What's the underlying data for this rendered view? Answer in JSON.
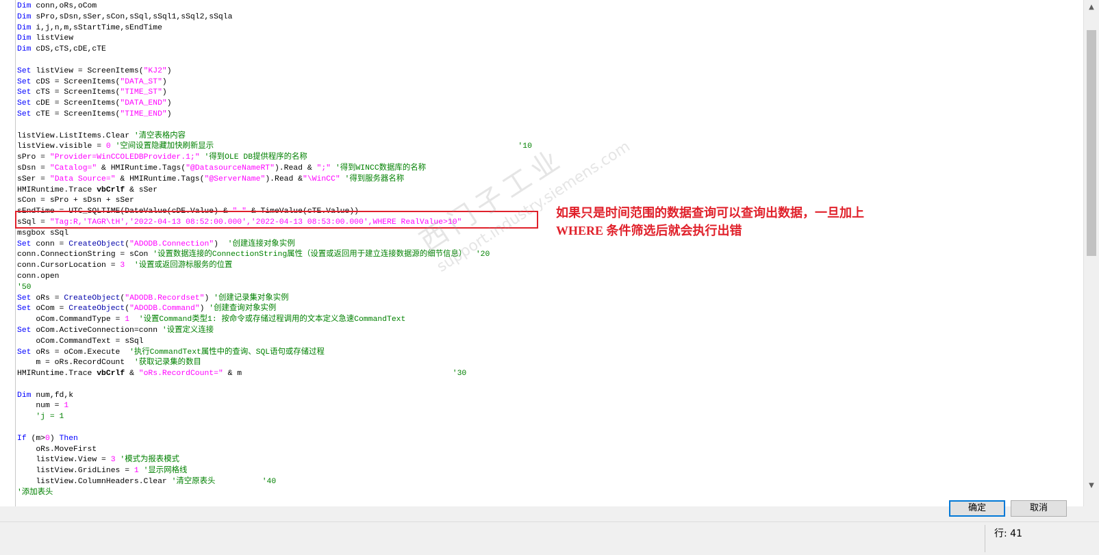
{
  "editor": {
    "lines": [
      [
        {
          "t": "Dim",
          "c": "kw"
        },
        {
          "t": " conn,oRs,oCom"
        }
      ],
      [
        {
          "t": "Dim",
          "c": "kw"
        },
        {
          "t": " sPro,sDsn,sSer,sCon,sSql,sSql1,sSql2,sSqla"
        }
      ],
      [
        {
          "t": "Dim",
          "c": "kw"
        },
        {
          "t": " i,j,n,m,sStartTime,sEndTime"
        }
      ],
      [
        {
          "t": "Dim",
          "c": "kw"
        },
        {
          "t": " listView"
        }
      ],
      [
        {
          "t": "Dim",
          "c": "kw"
        },
        {
          "t": " cDS,cTS,cDE,cTE"
        }
      ],
      [],
      [
        {
          "t": "Set",
          "c": "kw"
        },
        {
          "t": " listView = ScreenItems("
        },
        {
          "t": "\"KJ2\"",
          "c": "str"
        },
        {
          "t": ")"
        }
      ],
      [
        {
          "t": "Set",
          "c": "kw"
        },
        {
          "t": " cDS = ScreenItems("
        },
        {
          "t": "\"DATA_ST\"",
          "c": "str"
        },
        {
          "t": ")"
        }
      ],
      [
        {
          "t": "Set",
          "c": "kw"
        },
        {
          "t": " cTS = ScreenItems("
        },
        {
          "t": "\"TIME_ST\"",
          "c": "str"
        },
        {
          "t": ")"
        }
      ],
      [
        {
          "t": "Set",
          "c": "kw"
        },
        {
          "t": " cDE = ScreenItems("
        },
        {
          "t": "\"DATA_END\"",
          "c": "str"
        },
        {
          "t": ")"
        }
      ],
      [
        {
          "t": "Set",
          "c": "kw"
        },
        {
          "t": " cTE = ScreenItems("
        },
        {
          "t": "\"TIME_END\"",
          "c": "str"
        },
        {
          "t": ")"
        }
      ],
      [],
      [
        {
          "t": "listView.ListItems.Clear "
        },
        {
          "t": "'清空表格内容",
          "c": "cm"
        }
      ],
      [
        {
          "t": "listView.visible = "
        },
        {
          "t": "0",
          "c": "num"
        },
        {
          "t": " "
        },
        {
          "t": "'空间设置隐藏加快刷新显示                                                                 '10",
          "c": "cm"
        }
      ],
      [
        {
          "t": "sPro = "
        },
        {
          "t": "\"Provider=WinCCOLEDBProvider.1;\"",
          "c": "str"
        },
        {
          "t": " "
        },
        {
          "t": "'得到OLE DB提供程序的名称",
          "c": "cm"
        }
      ],
      [
        {
          "t": "sDsn = "
        },
        {
          "t": "\"Catalog=\"",
          "c": "str"
        },
        {
          "t": " & HMIRuntime.Tags("
        },
        {
          "t": "\"@DatasourceNameRT\"",
          "c": "str"
        },
        {
          "t": ").Read & "
        },
        {
          "t": "\";\"",
          "c": "str"
        },
        {
          "t": " "
        },
        {
          "t": "'得到WINCC数据库的名称",
          "c": "cm"
        }
      ],
      [
        {
          "t": "sSer = "
        },
        {
          "t": "\"Data Source=\"",
          "c": "str"
        },
        {
          "t": " & HMIRuntime.Tags("
        },
        {
          "t": "\"@ServerName\"",
          "c": "str"
        },
        {
          "t": ").Read &"
        },
        {
          "t": "\"\\WinCC\"",
          "c": "str"
        },
        {
          "t": " "
        },
        {
          "t": "'得到服务器名称",
          "c": "cm"
        }
      ],
      [
        {
          "t": "HMIRuntime.Trace "
        },
        {
          "t": "vbCrlf",
          "c": "bold"
        },
        {
          "t": " & sSer"
        }
      ],
      [
        {
          "t": "sCon = sPro + sDsn + sSer"
        }
      ],
      [
        {
          "t": "sEndTime = UTC_SQLTIME(DateValue(cDE.Value) & "
        },
        {
          "t": "\" \"",
          "c": "str"
        },
        {
          "t": " & TimeValue(cTE.Value))"
        }
      ],
      [
        {
          "t": "sSql = "
        },
        {
          "t": "\"Tag:R,'TAGR\\tH','2022-04-13 08:52:00.000','2022-04-13 08:53:00.000',WHERE RealValue>10\"",
          "c": "str"
        }
      ],
      [
        {
          "t": "msgbox sSql"
        }
      ],
      [
        {
          "t": "Set",
          "c": "kw"
        },
        {
          "t": " conn = "
        },
        {
          "t": "CreateObject",
          "c": "cb"
        },
        {
          "t": "("
        },
        {
          "t": "\"ADODB.Connection\"",
          "c": "str"
        },
        {
          "t": ")  "
        },
        {
          "t": "'创建连接对象实例",
          "c": "cm"
        }
      ],
      [
        {
          "t": "conn.ConnectionString = sCon "
        },
        {
          "t": "'设置数据连接的ConnectionString属性（设置或返回用于建立连接数据源的细节信息）  '20",
          "c": "cm"
        }
      ],
      [
        {
          "t": "conn.CursorLocation = "
        },
        {
          "t": "3",
          "c": "num"
        },
        {
          "t": "  "
        },
        {
          "t": "'设置或返回游标服务的位置",
          "c": "cm"
        }
      ],
      [
        {
          "t": "conn.open"
        }
      ],
      [
        {
          "t": "'50",
          "c": "cm"
        }
      ],
      [
        {
          "t": "Set",
          "c": "kw"
        },
        {
          "t": " oRs = "
        },
        {
          "t": "CreateObject",
          "c": "cb"
        },
        {
          "t": "("
        },
        {
          "t": "\"ADODB.Recordset\"",
          "c": "str"
        },
        {
          "t": ") "
        },
        {
          "t": "'创建记录集对象实例",
          "c": "cm"
        }
      ],
      [
        {
          "t": "Set",
          "c": "kw"
        },
        {
          "t": " oCom = "
        },
        {
          "t": "CreateObject",
          "c": "cb"
        },
        {
          "t": "("
        },
        {
          "t": "\"ADODB.Command\"",
          "c": "str"
        },
        {
          "t": ") "
        },
        {
          "t": "'创建查询对象实例",
          "c": "cm"
        }
      ],
      [
        {
          "t": "    oCom.CommandType = "
        },
        {
          "t": "1",
          "c": "num"
        },
        {
          "t": "  "
        },
        {
          "t": "'设置Command类型1: 按命令或存储过程调用的文本定义急速CommandText",
          "c": "cm"
        }
      ],
      [
        {
          "t": "Set",
          "c": "kw"
        },
        {
          "t": " oCom.ActiveConnection=conn "
        },
        {
          "t": "'设置定义连接",
          "c": "cm"
        }
      ],
      [
        {
          "t": "    oCom.CommandText = sSql"
        }
      ],
      [
        {
          "t": "Set",
          "c": "kw"
        },
        {
          "t": " oRs = oCom.Execute  "
        },
        {
          "t": "'执行CommandText属性中的查询、SQL语句或存储过程",
          "c": "cm"
        }
      ],
      [
        {
          "t": "    m = oRs.RecordCount  "
        },
        {
          "t": "'获取记录集的数目",
          "c": "cm"
        }
      ],
      [
        {
          "t": "HMIRuntime.Trace "
        },
        {
          "t": "vbCrlf",
          "c": "bold"
        },
        {
          "t": " & "
        },
        {
          "t": "\"oRs.RecordCount=\"",
          "c": "str"
        },
        {
          "t": " & m                                             "
        },
        {
          "t": "'30",
          "c": "cm"
        }
      ],
      [],
      [
        {
          "t": "Dim",
          "c": "kw"
        },
        {
          "t": " num,fd,k"
        }
      ],
      [
        {
          "t": "    num = "
        },
        {
          "t": "1",
          "c": "num"
        }
      ],
      [
        {
          "t": "    "
        },
        {
          "t": "'j = 1",
          "c": "cm"
        }
      ],
      [],
      [
        {
          "t": "If",
          "c": "kw"
        },
        {
          "t": " (m>"
        },
        {
          "t": "0",
          "c": "num"
        },
        {
          "t": ") "
        },
        {
          "t": "Then",
          "c": "kw"
        }
      ],
      [
        {
          "t": "    oRs.MoveFirst"
        }
      ],
      [
        {
          "t": "    listView.View = "
        },
        {
          "t": "3",
          "c": "num"
        },
        {
          "t": " "
        },
        {
          "t": "'模式为报表模式",
          "c": "cm"
        }
      ],
      [
        {
          "t": "    listView.GridLines = "
        },
        {
          "t": "1",
          "c": "num"
        },
        {
          "t": " "
        },
        {
          "t": "'显示网格线",
          "c": "cm"
        }
      ],
      [
        {
          "t": "    listView.ColumnHeaders.Clear "
        },
        {
          "t": "'清空原表头          '40",
          "c": "cm"
        }
      ],
      [
        {
          "t": "'添加表头",
          "c": "cm"
        }
      ]
    ]
  },
  "annotation": {
    "text": "如果只是时间范围的数据查询可以查询出数据，一旦加上WHERE 条件筛选后就会执行出错",
    "color": "#e0202a"
  },
  "watermark": {
    "cn": "西门子工业",
    "en": "support.industry.siemens.com"
  },
  "buttons": {
    "ok": "确定",
    "cancel": "取消"
  },
  "status": {
    "line_label": "行:",
    "line_value": "41"
  },
  "scroll": {
    "up_icon": "▲",
    "down_icon": "▼"
  }
}
